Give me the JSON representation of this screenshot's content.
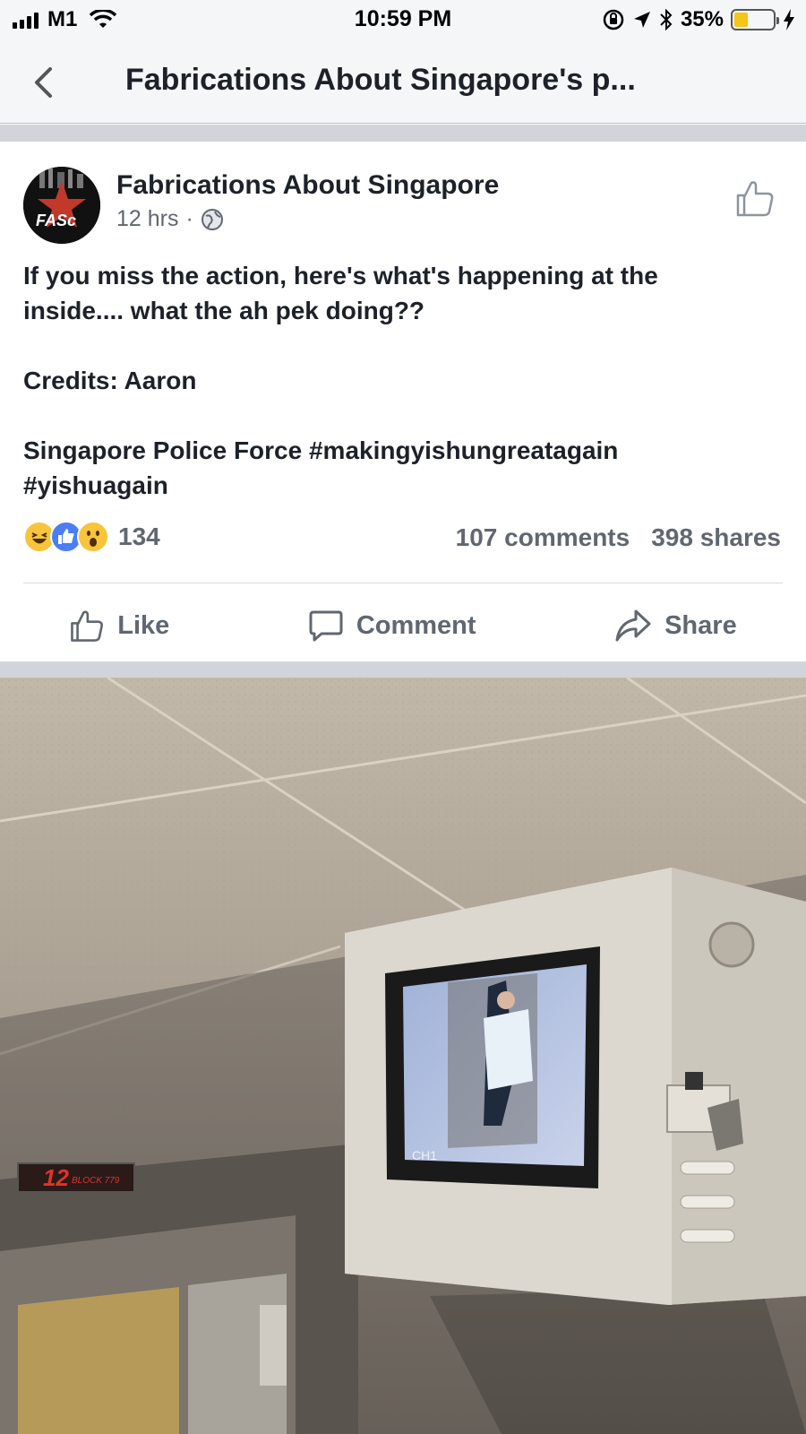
{
  "status_bar": {
    "carrier": "M1",
    "time": "10:59 PM",
    "battery_percent": "35%",
    "battery_level": 0.35
  },
  "nav": {
    "title": "Fabrications About Singapore's p..."
  },
  "post": {
    "page_name": "Fabrications About Singapore",
    "time_ago": "12 hrs",
    "separator": "·",
    "text_lines": [
      "If you miss the action, here's what's happening at the",
      "inside.... what the ah pek doing??",
      "",
      "Credits: Aaron",
      "",
      "Singapore Police Force #makingyishungreatagain",
      "#yishuagain"
    ],
    "reaction_count": "134",
    "comments": "107 comments",
    "shares": "398 shares",
    "actions": {
      "like": "Like",
      "comment": "Comment",
      "share": "Share"
    }
  },
  "photo": {
    "floor_display": "12",
    "block_label": "BLOCK 779",
    "monitor_label": "CH1"
  },
  "colors": {
    "bar_bg": "#f5f6f7",
    "text_dark": "#1d2129",
    "text_gray": "#606770",
    "separator_gray": "#d1d5da",
    "battery_yellow": "#f5c518",
    "like_blue": "#4a7ef2",
    "reaction_yellow": "#f7c43b"
  }
}
